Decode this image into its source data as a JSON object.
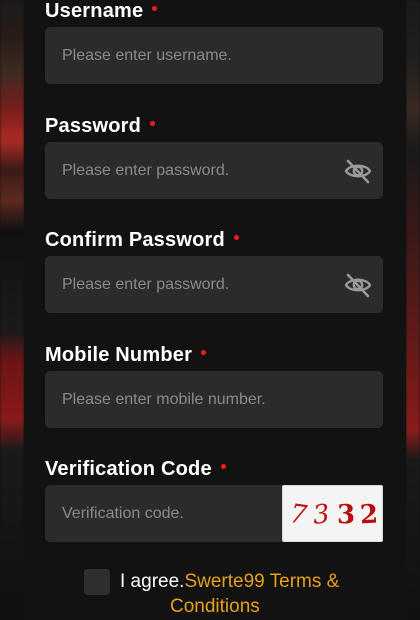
{
  "form": {
    "username": {
      "label": "Username",
      "placeholder": "Please enter username."
    },
    "password": {
      "label": "Password",
      "placeholder": "Please enter password."
    },
    "confirm_password": {
      "label": "Confirm Password",
      "placeholder": "Please enter password."
    },
    "mobile": {
      "label": "Mobile Number",
      "placeholder": "Please enter mobile number."
    },
    "verification": {
      "label": "Verification Code",
      "placeholder": "Verification code.",
      "captcha_digits": [
        "7",
        "3",
        "3",
        "2"
      ]
    },
    "agree": {
      "prefix": "I agree.",
      "link_part1": "Swerte99 Terms &",
      "link_part2": "Conditions"
    }
  },
  "icons": {
    "password_toggle": "eye-slash-icon",
    "confirm_toggle": "eye-slash-icon"
  },
  "colors": {
    "background": "#121212",
    "input_bg": "#2b2b2b",
    "required_dot": "#ff1a1a",
    "link": "#e7a019",
    "captcha_text": "#c21010"
  }
}
